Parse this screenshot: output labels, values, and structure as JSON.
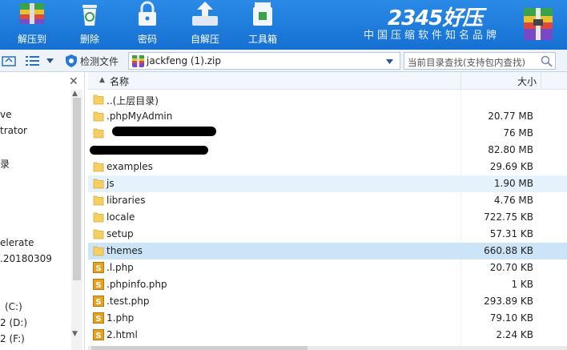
{
  "toolbar": {
    "buttons": [
      {
        "label": "解压到",
        "icon": "extract-icon"
      },
      {
        "label": "删除",
        "icon": "trash-icon"
      },
      {
        "label": "密码",
        "icon": "lock-icon"
      },
      {
        "label": "自解压",
        "icon": "self-extract-icon"
      },
      {
        "label": "工具箱",
        "icon": "toolbox-icon"
      }
    ],
    "brand": {
      "name": "2345好压",
      "slogan": "中国压缩软件知名品牌"
    }
  },
  "address": {
    "detect_label": "检测文件",
    "path": "jackfeng (1).zip",
    "search_placeholder": "当前目录查找(支持包内查找)"
  },
  "left_panel": {
    "items": [
      {
        "text": "ve"
      },
      {
        "text": "trator"
      },
      {
        "text": "录"
      },
      {
        "text": "elerate"
      },
      {
        "text": ".20180309"
      },
      {
        "text": "(C:)"
      },
      {
        "text": "2 (D:)"
      },
      {
        "text": "2 (F:)"
      }
    ]
  },
  "file_list": {
    "columns": {
      "name": "名称",
      "size": "大小"
    },
    "rows": [
      {
        "name": "..(上层目录)",
        "size": "",
        "type": "folder"
      },
      {
        "name": ".phpMyAdmin",
        "size": "20.77 MB",
        "type": "folder"
      },
      {
        "name": "",
        "size": "76 MB",
        "type": "folder"
      },
      {
        "name": "",
        "size": "82.80 MB",
        "type": "folder"
      },
      {
        "name": "examples",
        "size": "29.69 KB",
        "type": "folder"
      },
      {
        "name": "js",
        "size": "1.90 MB",
        "type": "folder"
      },
      {
        "name": "libraries",
        "size": "4.76 MB",
        "type": "folder"
      },
      {
        "name": "locale",
        "size": "722.75 KB",
        "type": "folder"
      },
      {
        "name": "setup",
        "size": "57.31 KB",
        "type": "folder"
      },
      {
        "name": "themes",
        "size": "660.88 KB",
        "type": "folder"
      },
      {
        "name": ".l.php",
        "size": "20.70 KB",
        "type": "php"
      },
      {
        "name": ".phpinfo.php",
        "size": "1 KB",
        "type": "php"
      },
      {
        "name": ".test.php",
        "size": "293.89 KB",
        "type": "php"
      },
      {
        "name": "1.php",
        "size": "79.10 KB",
        "type": "php"
      },
      {
        "name": "2.html",
        "size": "2.24 KB",
        "type": "php"
      }
    ]
  },
  "colors": {
    "accent": "#1a78dc",
    "selected_row": "#cce4f7",
    "folder": "#f5cf62"
  }
}
